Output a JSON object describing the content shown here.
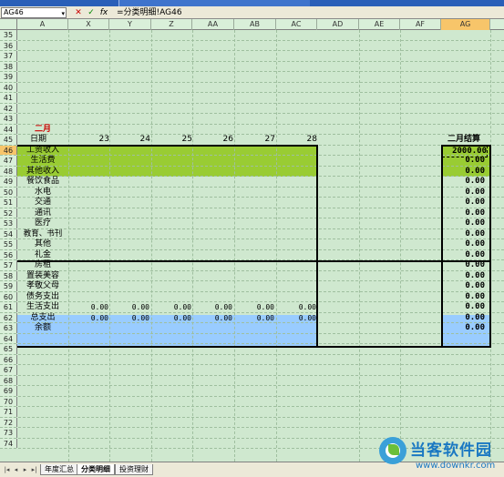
{
  "formula_bar": {
    "name_box": "AG46",
    "formula": "=分类明细!AG46",
    "cancel_symbol": "✕",
    "enter_symbol": "✓",
    "fx_symbol": "fx"
  },
  "columns": [
    "A",
    "X",
    "Y",
    "Z",
    "AA",
    "AB",
    "AC",
    "AD",
    "AE",
    "AF",
    "AG"
  ],
  "selected_column": "AG",
  "selected_row": "46",
  "rows": [
    {
      "num": "35",
      "a": ""
    },
    {
      "num": "36",
      "a": ""
    },
    {
      "num": "37",
      "a": ""
    },
    {
      "num": "38",
      "a": ""
    },
    {
      "num": "39",
      "a": ""
    },
    {
      "num": "40",
      "a": ""
    },
    {
      "num": "41",
      "a": ""
    },
    {
      "num": "42",
      "a": ""
    },
    {
      "num": "43",
      "a": ""
    },
    {
      "num": "44",
      "a": "二月"
    },
    {
      "num": "45",
      "a": "日期"
    },
    {
      "num": "46",
      "a": "工资收入"
    },
    {
      "num": "47",
      "a": "生活费"
    },
    {
      "num": "48",
      "a": "其他收入"
    },
    {
      "num": "49",
      "a": "餐饮食品"
    },
    {
      "num": "50",
      "a": "水电"
    },
    {
      "num": "51",
      "a": "交通"
    },
    {
      "num": "52",
      "a": "通讯"
    },
    {
      "num": "53",
      "a": "医疗"
    },
    {
      "num": "54",
      "a": "教育、书刊"
    },
    {
      "num": "55",
      "a": "其他"
    },
    {
      "num": "56",
      "a": "礼金"
    },
    {
      "num": "57",
      "a": "房租"
    },
    {
      "num": "58",
      "a": "置装美容"
    },
    {
      "num": "59",
      "a": "孝敬父母"
    },
    {
      "num": "60",
      "a": "债务支出"
    },
    {
      "num": "61",
      "a": "生活支出"
    },
    {
      "num": "62",
      "a": "总支出"
    },
    {
      "num": "63",
      "a": "余额"
    },
    {
      "num": "64",
      "a": ""
    },
    {
      "num": "65",
      "a": ""
    },
    {
      "num": "66",
      "a": ""
    },
    {
      "num": "67",
      "a": ""
    },
    {
      "num": "68",
      "a": ""
    },
    {
      "num": "69",
      "a": ""
    },
    {
      "num": "70",
      "a": ""
    },
    {
      "num": "71",
      "a": ""
    },
    {
      "num": "72",
      "a": ""
    },
    {
      "num": "73",
      "a": ""
    },
    {
      "num": "74",
      "a": ""
    }
  ],
  "days": [
    "23",
    "24",
    "25",
    "26",
    "27",
    "28"
  ],
  "summary_header": "二月结算",
  "ag_values": {
    "46": "2000.00",
    "47": "0.00",
    "48": "0.00",
    "49": "0.00",
    "50": "0.00",
    "51": "0.00",
    "52": "0.00",
    "53": "0.00",
    "54": "0.00",
    "55": "0.00",
    "56": "0.00",
    "57": "0.00",
    "58": "0.00",
    "59": "0.00",
    "60": "0.00",
    "61": "0.00",
    "62": "0.00",
    "63": "0.00"
  },
  "daily_zero": "0.00",
  "colors": {
    "income_band": "#99cc33",
    "total_band": "#99ccff",
    "month_label": "#cc0000",
    "sheet_background": "#cfe8cf",
    "selected_header": "#f7c56a"
  },
  "sheet_tabs": [
    "年度汇总",
    "分类明细",
    "投资理财"
  ],
  "active_tab": "分类明细",
  "watermark": {
    "title": "当客软件园",
    "url": "www.downkr.com",
    "icon": "downkr-logo-icon"
  }
}
